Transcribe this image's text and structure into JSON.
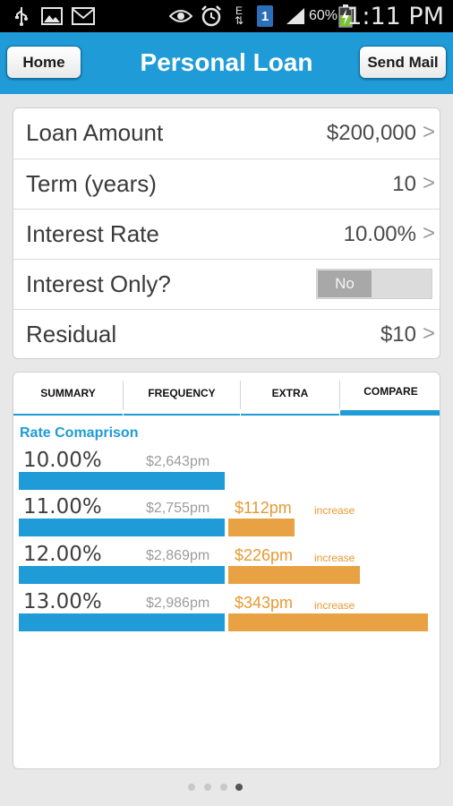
{
  "status_bar": {
    "battery_percent": "60%",
    "time": "1:11 PM",
    "network_type": "E",
    "sim_badge": "1",
    "icons": [
      "usb-icon",
      "image-icon",
      "mail-icon",
      "eye-icon",
      "alarm-icon",
      "network-icon",
      "sim-icon",
      "signal-icon",
      "battery-charging-icon"
    ]
  },
  "header": {
    "home_label": "Home",
    "title": "Personal Loan",
    "send_mail_label": "Send Mail"
  },
  "form": {
    "rows": [
      {
        "label": "Loan Amount",
        "value": "$200,000",
        "chevron": ">"
      },
      {
        "label": "Term (years)",
        "value": "10",
        "chevron": ">"
      },
      {
        "label": "Interest Rate",
        "value": "10.00%",
        "chevron": ">"
      },
      {
        "label": "Interest Only?",
        "value": "No"
      },
      {
        "label": "Residual",
        "value": "$10",
        "chevron": ">"
      }
    ]
  },
  "tabs": [
    {
      "label": "SUMMARY"
    },
    {
      "label": "FREQUENCY"
    },
    {
      "label": "EXTRA"
    },
    {
      "label": "COMPARE",
      "active": true
    }
  ],
  "compare": {
    "section_title": "Rate Comaprison",
    "rows": [
      {
        "rate": "10.00%",
        "monthly": "$2,643pm",
        "diff": "",
        "diff_label": "",
        "diff_fraction": 0
      },
      {
        "rate": "11.00%",
        "monthly": "$2,755pm",
        "diff": "$112pm",
        "diff_label": "increase",
        "diff_fraction": 0.33
      },
      {
        "rate": "12.00%",
        "monthly": "$2,869pm",
        "diff": "$226pm",
        "diff_label": "increase",
        "diff_fraction": 0.66
      },
      {
        "rate": "13.00%",
        "monthly": "$2,986pm",
        "diff": "$343pm",
        "diff_label": "increase",
        "diff_fraction": 1.0
      }
    ]
  },
  "pager": {
    "count": 4,
    "active_index": 3
  },
  "colors": {
    "accent_blue": "#1f9bd7",
    "accent_orange": "#e8a243"
  }
}
